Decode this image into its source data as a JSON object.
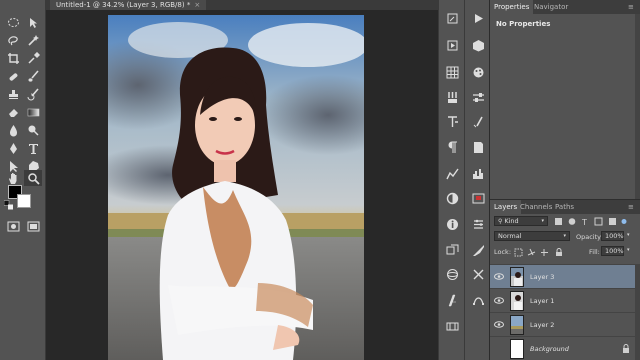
{
  "document": {
    "tab_title": "Untitled-1 @ 34.2% (Layer 3, RGB/8) *",
    "close_glyph": "×"
  },
  "toolbar": {
    "tools": [
      "marquee-icon",
      "move-icon",
      "lasso-icon",
      "magic-wand-icon",
      "crop-icon",
      "eyedropper-icon",
      "healing-brush-icon",
      "brush-icon",
      "clone-stamp-icon",
      "history-brush-icon",
      "eraser-icon",
      "gradient-icon",
      "blur-icon",
      "dodge-icon",
      "pen-icon",
      "type-icon",
      "path-selection-icon",
      "shape-icon",
      "hand-icon",
      "zoom-icon",
      "quick-mask-icon",
      "screen-mode-icon"
    ],
    "foreground_color": "#000000",
    "background_color": "#ffffff"
  },
  "properties_panel": {
    "tabs": [
      "Properties",
      "Navigator"
    ],
    "active_tab": "Properties",
    "title": "No Properties"
  },
  "layers_panel": {
    "tabs": [
      "Layers",
      "Channels",
      "Paths"
    ],
    "active_tab": "Layers",
    "filter_label": "Kind",
    "blend_mode": "Normal",
    "opacity_label": "Opacity:",
    "opacity_value": "100%",
    "lock_label": "Lock:",
    "fill_label": "Fill:",
    "fill_value": "100%",
    "layers": [
      {
        "name": "Layer 3",
        "selected": true,
        "italic": false
      },
      {
        "name": "Layer 1",
        "selected": false,
        "italic": false
      },
      {
        "name": "Layer 2",
        "selected": false,
        "italic": false
      },
      {
        "name": "Background",
        "selected": false,
        "italic": true,
        "locked": true
      }
    ]
  },
  "colors": {
    "ui_panel": "#535353",
    "ui_dark": "#282828",
    "selection": "#6f7f92"
  }
}
